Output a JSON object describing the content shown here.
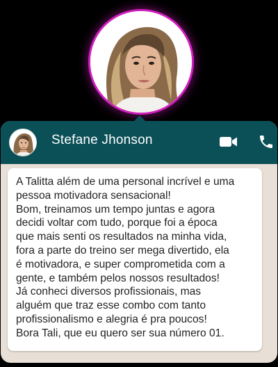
{
  "contact": {
    "name": "Stefane Jhonson"
  },
  "colors": {
    "header_bg": "#0b4f57",
    "glow": "#d11fbf",
    "chat_bg": "#e8dfd6",
    "bubble_bg": "#ffffff"
  },
  "icons": {
    "video": "video-camera-icon",
    "phone": "phone-icon"
  },
  "message": {
    "lines": [
      "A Talitta além de uma personal incrível e uma",
      "pessoa motivadora sensacional!",
      "Bom, treinamos um tempo juntas e agora",
      "decidi voltar com tudo, porque foi a época",
      "que mais senti os resultados na minha vida,",
      "fora a parte do treino ser mega divertido, ela",
      "é motivadora, e super comprometida com a",
      "gente, e também pelos nossos resultados!",
      "Já conheci diversos profissionais, mas",
      "alguém que traz esse combo com tanto",
      "profissionalismo e alegria é pra poucos!",
      "Bora Tali, que eu quero ser sua número 01."
    ]
  }
}
